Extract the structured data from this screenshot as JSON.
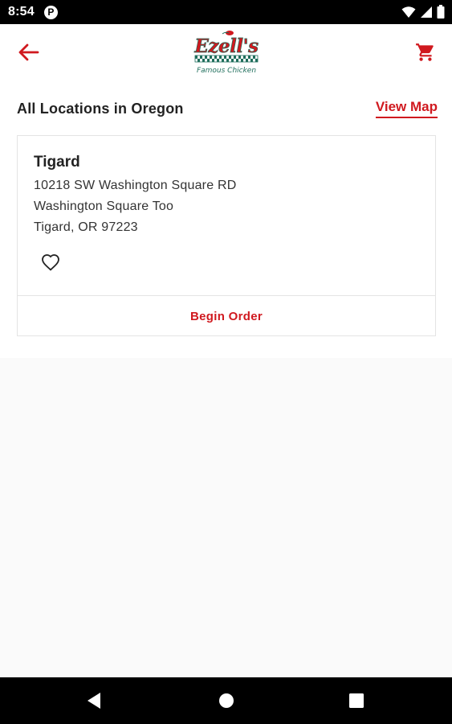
{
  "status_bar": {
    "time": "8:54",
    "notification_badge": "P",
    "icons": [
      "wifi-icon",
      "cellular-signal-icon",
      "battery-icon"
    ]
  },
  "app_bar": {
    "back_icon": "arrow-left-icon",
    "logo": {
      "brand_text": "Ezell's",
      "tagline": "Famous Chicken"
    },
    "cart_icon": "shopping-cart-icon"
  },
  "locations": {
    "heading": "All Locations in Oregon",
    "view_map_label": "View Map",
    "items": [
      {
        "name": "Tigard",
        "address_line1": "10218 SW Washington Square RD",
        "address_line2": "Washington Square Too",
        "address_line3": "Tigard, OR 97223",
        "favorite_icon": "heart-outline-icon",
        "action_label": "Begin Order"
      }
    ]
  },
  "nav_bar": {
    "icons": [
      "back-triangle-icon",
      "home-circle-icon",
      "recents-square-icon"
    ]
  },
  "colors": {
    "accent": "#d0191f",
    "logo_green": "#1f6e5c",
    "background": "#fafafa",
    "surface": "#ffffff"
  }
}
